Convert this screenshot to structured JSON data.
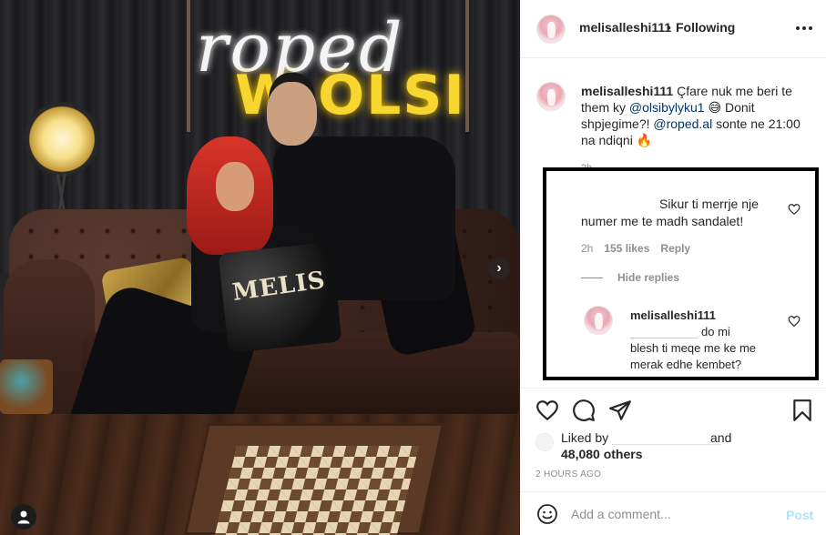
{
  "post": {
    "username": "melisalleshi111",
    "dot": "•",
    "follow_status": "Following",
    "more_icon": "more-horizontal-icon"
  },
  "photo": {
    "neon_script": "roped",
    "neon_sign": "W OLSI",
    "pillow_text": "MELIS",
    "carousel_icon": "chevron-right-icon",
    "tagged_icon": "user-tag-icon"
  },
  "caption": {
    "username": "melisalleshi111",
    "text_1": " Çfare nuk me beri te them ky ",
    "mention_1": "@olsibylyku1",
    "text_2": " 😅 Donit shpjegime?! ",
    "mention_2": "@roped.al",
    "text_3": " sonte ne 21:00 na ndiqni 🔥",
    "time": "2h"
  },
  "comment": {
    "text_line_1": "Sikur ti merrje nje",
    "text_line_2": "numer me te madh sandalet!",
    "time": "2h",
    "likes": "155 likes",
    "reply_label": "Reply",
    "hide_replies": "Hide replies"
  },
  "reply": {
    "username": "melisalleshi111",
    "text_1": "do mi",
    "text_2": "blesh ti meqe me ke me merak edhe kembet?"
  },
  "actions": {
    "like_icon": "heart-icon",
    "comment_icon": "comment-icon",
    "share_icon": "send-icon",
    "save_icon": "bookmark-icon"
  },
  "likes": {
    "liked_by": "Liked by",
    "and": "and",
    "others": "48,080 others"
  },
  "timestamp": "2 HOURS AGO",
  "add_comment": {
    "placeholder": "Add a comment...",
    "post_label": "Post",
    "emoji_icon": "smiley-icon"
  },
  "colors": {
    "link": "#00376b",
    "muted": "#8e8e8e",
    "post_disabled": "#b2dffc",
    "text": "#262626"
  }
}
